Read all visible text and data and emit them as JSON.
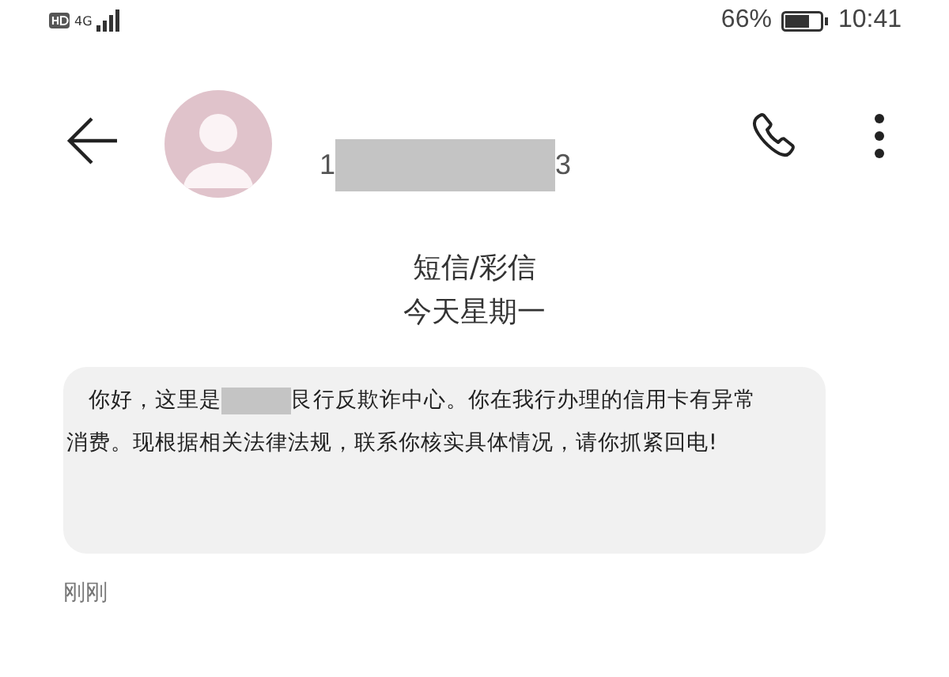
{
  "status_bar": {
    "network": "4G",
    "battery_percent": "66%",
    "time": "10:41"
  },
  "header": {
    "number_start": "1",
    "number_end": "3"
  },
  "conversation": {
    "channel": "短信/彩信",
    "date": "今天星期一"
  },
  "messages": [
    {
      "line1_before": "你好，这里是",
      "line1_after": "艮行反欺诈中心。你在我行办理的信用卡有异常",
      "line2": "消费。现根据相关法律法规，联系你核实具体情况，请你抓紧回电!",
      "time": "刚刚"
    }
  ]
}
